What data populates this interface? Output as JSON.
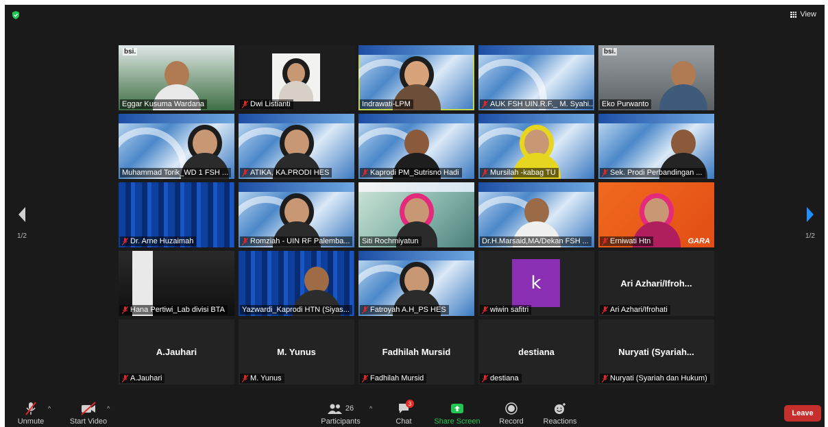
{
  "top": {
    "view_label": "View"
  },
  "nav": {
    "page_left": "1/2",
    "page_right": "1/2"
  },
  "tiles": [
    {
      "name": "Eggar Kusuma Wardana",
      "muted": false
    },
    {
      "name": "Dwi Listianti",
      "muted": true
    },
    {
      "name": "Indrawati-LPM",
      "muted": false
    },
    {
      "name": "AUK FSH UIN.R.F._ M. Syahi...",
      "muted": true
    },
    {
      "name": "Eko Purwanto",
      "muted": false
    },
    {
      "name": "Muhammad Torik_WD 1 FSH ...",
      "muted": false
    },
    {
      "name": "ATIKA, KA.PRODI HES",
      "muted": true
    },
    {
      "name": "Kaprodi PM_Sutrisno Hadi",
      "muted": true
    },
    {
      "name": "Mursilah -kabag TU",
      "muted": true
    },
    {
      "name": "Sek. Prodi Perbandingan ...",
      "muted": true
    },
    {
      "name": "Dr. Arne Huzaimah",
      "muted": true
    },
    {
      "name": "Romziah - UIN RF Palemba...",
      "muted": true
    },
    {
      "name": "Siti Rochmiyatun",
      "muted": false
    },
    {
      "name": "Dr.H.Marsaid,MA/Dekan FSH ...",
      "muted": false
    },
    {
      "name": "Erniwati Htn",
      "muted": true
    },
    {
      "name": "Hana Pertiwi_Lab divisi BTA",
      "muted": true
    },
    {
      "name": "Yazwardi_Kaprodi HTN (Siyas...",
      "muted": false
    },
    {
      "name": "Fatroyah A.H_PS HES",
      "muted": true
    },
    {
      "name": "wiwin safitri",
      "muted": true
    },
    {
      "name": "Ari Azhari/Ifrohati",
      "muted": true
    },
    {
      "name": "A.Jauhari",
      "muted": true
    },
    {
      "name": "M. Yunus",
      "muted": true
    },
    {
      "name": "Fadhilah Mursid",
      "muted": true
    },
    {
      "name": "destiana",
      "muted": true
    },
    {
      "name": "Nuryati (Syariah dan Hukum)",
      "muted": true
    }
  ],
  "center_names": {
    "ari": "Ari Azhari/Ifroh...",
    "jauhari": "A.Jauhari",
    "yunus": "M. Yunus",
    "fadhilah": "Fadhilah Mursid",
    "destiana": "destiana",
    "nuryati": "Nuryati (Syariah..."
  },
  "avatar_letter": "k",
  "bsi_logo": "bsi.",
  "gara_text": "GARA",
  "toolbar": {
    "unmute": "Unmute",
    "start_video": "Start Video",
    "participants": "Participants",
    "participants_count": "26",
    "chat": "Chat",
    "chat_badge": "3",
    "share_screen": "Share Screen",
    "record": "Record",
    "reactions": "Reactions",
    "leave": "Leave"
  },
  "colors": {
    "leave": "#c5302d",
    "share": "#23c552",
    "active_speaker": "#c3d84a",
    "mute_red": "#e02828"
  }
}
